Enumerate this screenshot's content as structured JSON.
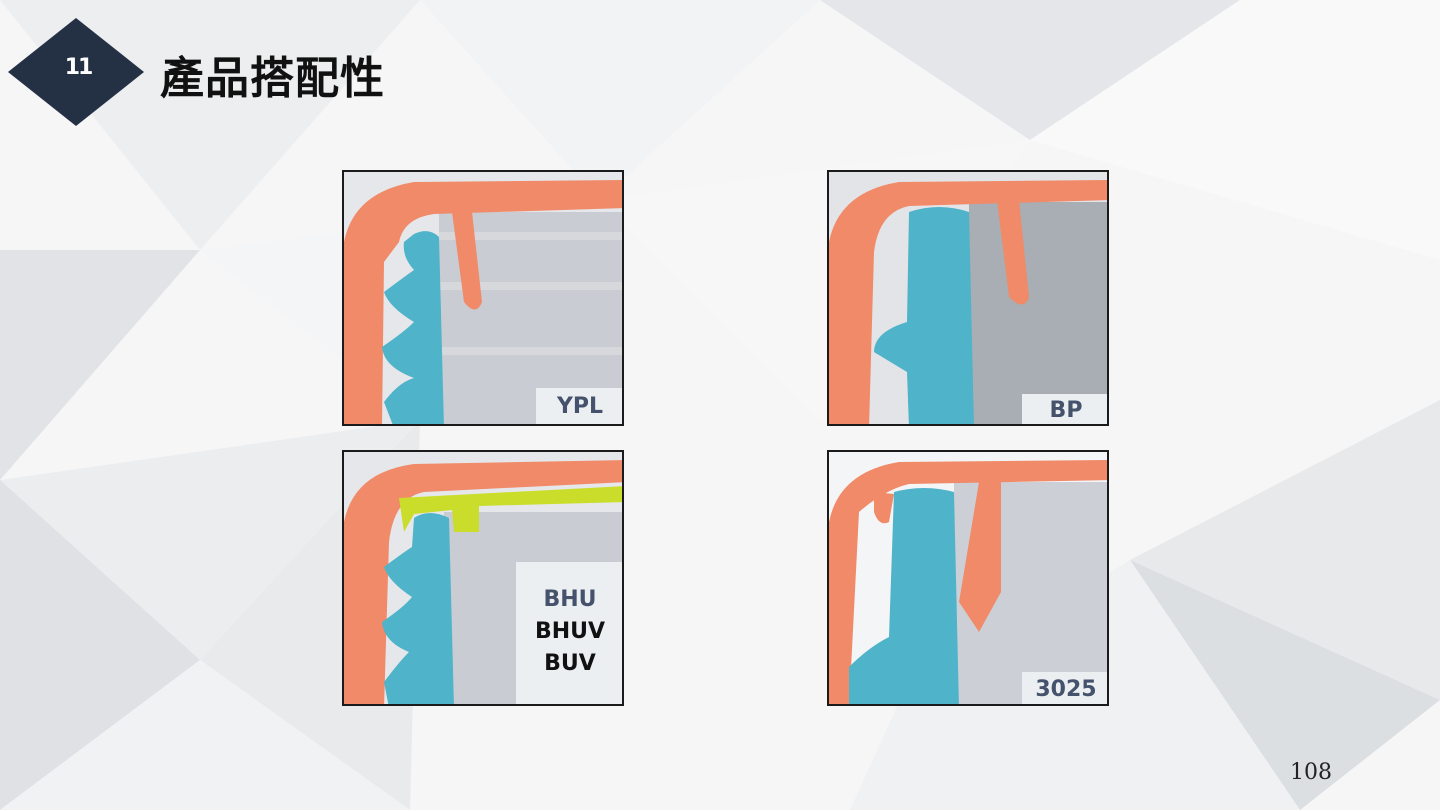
{
  "slide": {
    "section_number": "11",
    "title": "產品搭配性",
    "page_number": "108"
  },
  "panels": [
    {
      "id": "ypl",
      "labels": [
        "YPL"
      ]
    },
    {
      "id": "bp",
      "labels": [
        "BP"
      ]
    },
    {
      "id": "bhu",
      "labels": [
        "BHU",
        "BHUV",
        "BUV"
      ]
    },
    {
      "id": "p3025",
      "labels": [
        "3025"
      ]
    }
  ],
  "colors": {
    "cap_orange": "#f08a68",
    "seal_teal": "#4fb3c9",
    "liner_yellow": "#c9dd2a",
    "bottle_gray": "#c9ccd2",
    "header_dark": "#243044",
    "label_text": "#44526c"
  },
  "icons": {
    "section_badge": "diamond-badge-icon"
  }
}
